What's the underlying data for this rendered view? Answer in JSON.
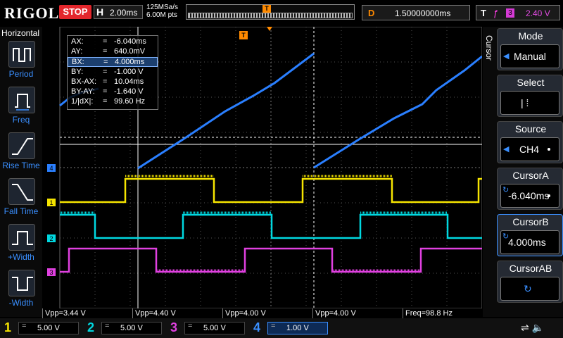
{
  "header": {
    "logo": "RIGOL",
    "run_state": "STOP",
    "horiz_label": "H",
    "timebase": "2.00ms",
    "sample_rate": "125MSa/s",
    "memory_depth": "6.00M pts",
    "trigger_marker": "T",
    "delay_label": "D",
    "delay_value": "1.50000000ms",
    "trigger_label": "T",
    "trigger_edge": "rising-edge-icon",
    "trigger_source": "3",
    "trigger_level": "2.40 V"
  },
  "left_menu": {
    "title": "Horizontal",
    "items": [
      {
        "label": "Period",
        "icon": "period-icon"
      },
      {
        "label": "Freq",
        "icon": "freq-icon"
      },
      {
        "label": "Rise Time",
        "icon": "rise-time-icon"
      },
      {
        "label": "Fall Time",
        "icon": "fall-time-icon"
      },
      {
        "label": "+Width",
        "icon": "pos-width-icon"
      },
      {
        "label": "-Width",
        "icon": "neg-width-icon"
      }
    ]
  },
  "cursor_info": {
    "rows": [
      {
        "k": "AX:",
        "v": "-6.040ms"
      },
      {
        "k": "AY:",
        "v": "640.0mV"
      },
      {
        "k": "BX:",
        "v": "4.000ms"
      },
      {
        "k": "BY:",
        "v": "-1.000 V"
      },
      {
        "k": "BX-AX:",
        "v": "10.04ms"
      },
      {
        "k": "BY-AY:",
        "v": "-1.640 V"
      },
      {
        "k": "1/|dX|:",
        "v": "99.60 Hz"
      }
    ],
    "eq": "="
  },
  "measurements": [
    "Vpp=3.44 V",
    "Vpp=4.40 V",
    "Vpp=4.00 V",
    "Vpp=4.00 V",
    "Freq=98.8 Hz"
  ],
  "right_menu": {
    "side_label": "Cursor",
    "items": [
      {
        "title": "Mode",
        "value": "Manual",
        "arrow": "◀"
      },
      {
        "title": "Select",
        "value": "|  ⁞",
        "arrow": ""
      },
      {
        "title": "Source",
        "value": "CH4",
        "arrow": "◀"
      },
      {
        "title": "CursorA",
        "value": "-6.040ms",
        "arrow": "↻"
      },
      {
        "title": "CursorB",
        "value": "4.000ms",
        "arrow": "↻"
      },
      {
        "title": "CursorAB",
        "value": "↻",
        "arrow": ""
      }
    ]
  },
  "channels": [
    {
      "num": "1",
      "coupling": "=",
      "scale": "5.00 V",
      "color": "#f5e400"
    },
    {
      "num": "2",
      "coupling": "=",
      "scale": "5.00 V",
      "color": "#00d8e0"
    },
    {
      "num": "3",
      "coupling": "=",
      "scale": "5.00 V",
      "color": "#e040e0"
    },
    {
      "num": "4",
      "coupling": "=",
      "scale": "1.00 V",
      "color": "#3a8fff"
    }
  ],
  "channel_markers": [
    "4",
    "1",
    "2",
    "3"
  ],
  "colors": {
    "ch1": "#f5e400",
    "ch2": "#00d8e0",
    "ch3": "#e040e0",
    "ch4": "#2a7fff",
    "trigger": "#ff8a00",
    "accent": "#3a8fff"
  }
}
